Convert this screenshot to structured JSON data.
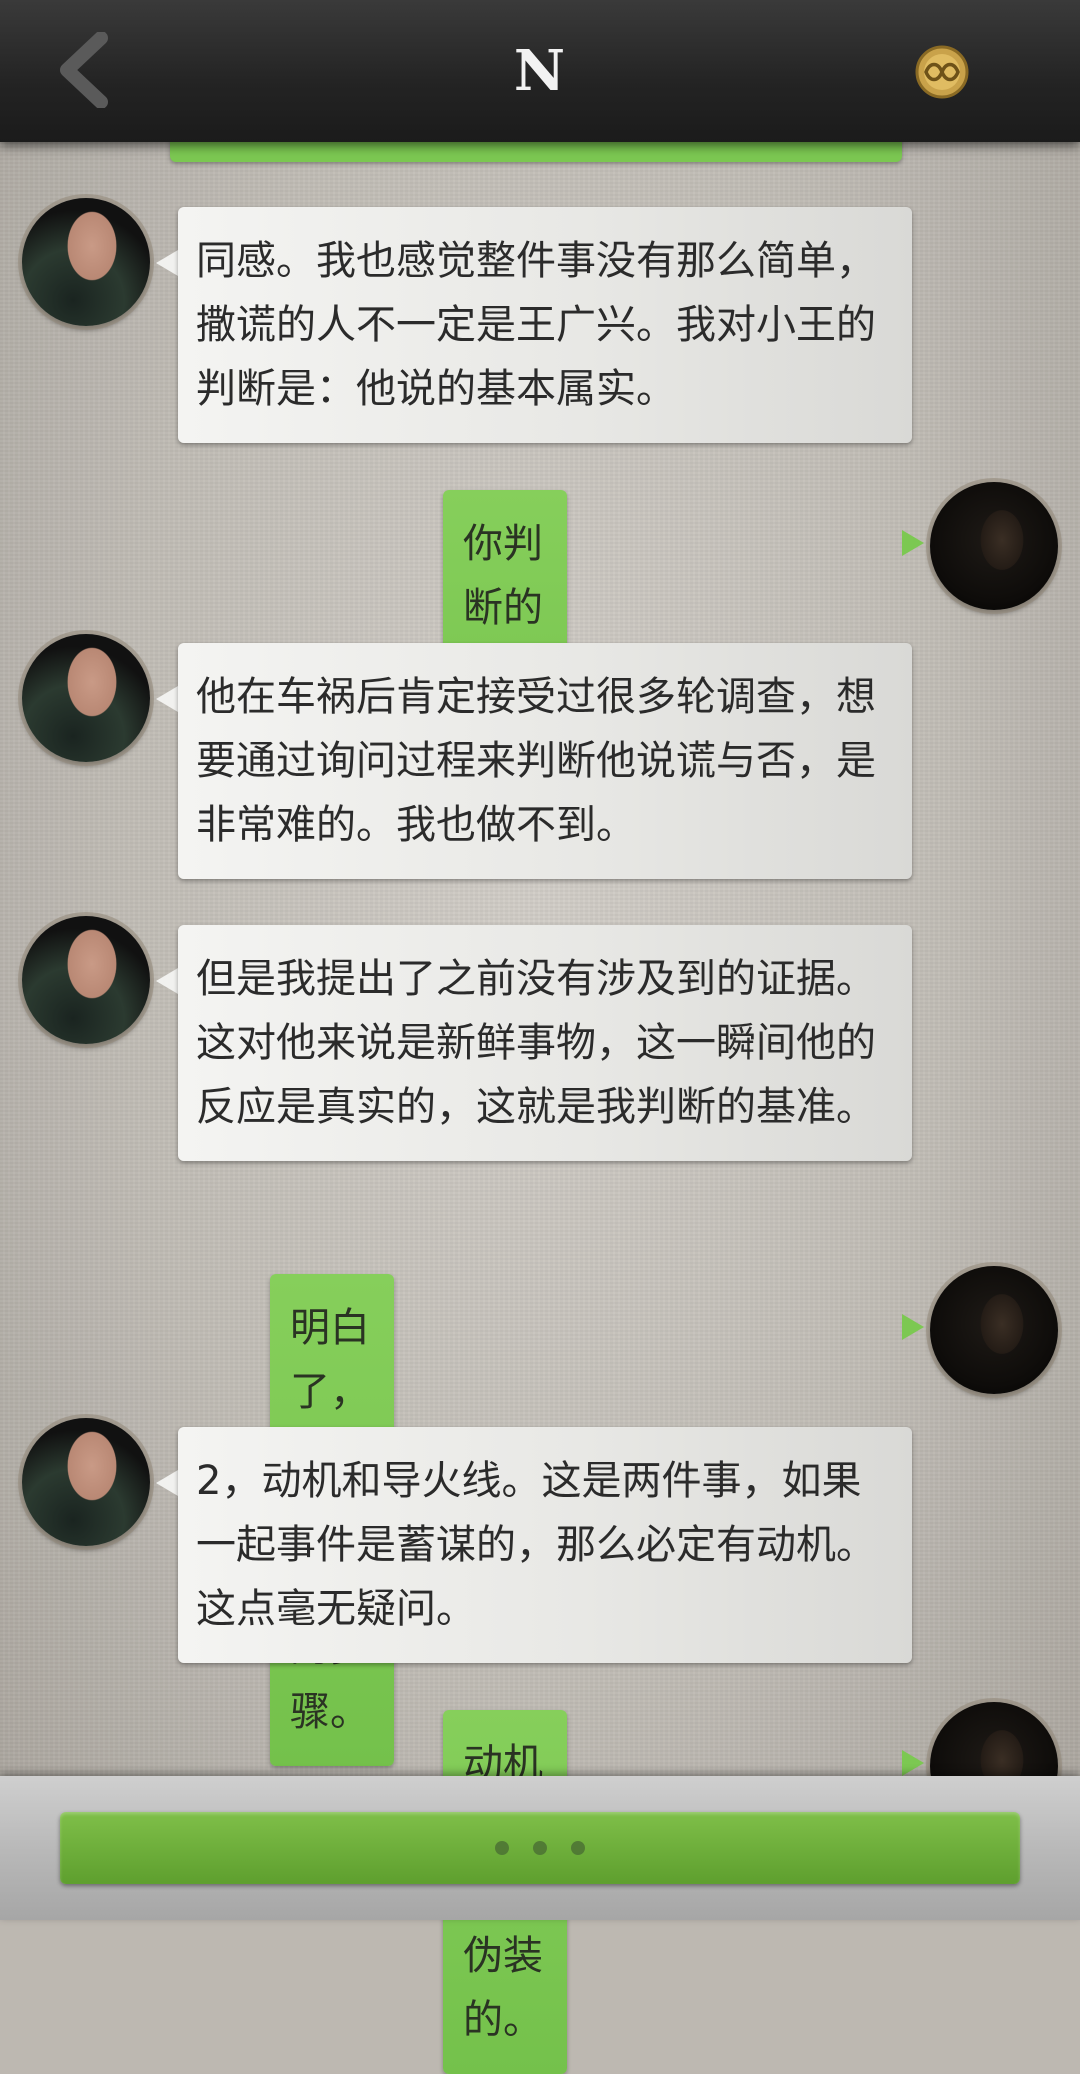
{
  "header": {
    "title": "N",
    "back_icon": "chevron-left-icon",
    "badge_icon": "infinity-coin-icon"
  },
  "messages": [
    {
      "side": "left",
      "text": "同感。我也感觉整件事没有那么简单，撒谎的人不一定是王广兴。我对小王的判断是：他说的基本属实。"
    },
    {
      "side": "right",
      "text": "你判断的基准是什么？"
    },
    {
      "side": "left",
      "text": "他在车祸后肯定接受过很多轮调查，想要通过询问过程来判断他说谎与否，是非常难的。我也做不到。"
    },
    {
      "side": "left",
      "text": "但是我提出了之前没有涉及到的证据。这对他来说是新鲜事物，这一瞬间他的反应是真实的，这就是我判断的基准。"
    },
    {
      "side": "right",
      "text": "明白了，继续说你调查的步骤。"
    },
    {
      "side": "left",
      "text": "2，动机和导火线。这是两件事，如果一起事件是蓄谋的，那么必定有动机。这点毫无疑问。"
    },
    {
      "side": "right",
      "text": "动机也是可以伪装的。"
    }
  ],
  "footer": {
    "button_icon": "typing-dots-icon"
  },
  "colors": {
    "header_bg": "#232323",
    "right_bubble": "#7cc852",
    "left_bubble": "#ececea",
    "continue_button": "#6aae3a"
  }
}
